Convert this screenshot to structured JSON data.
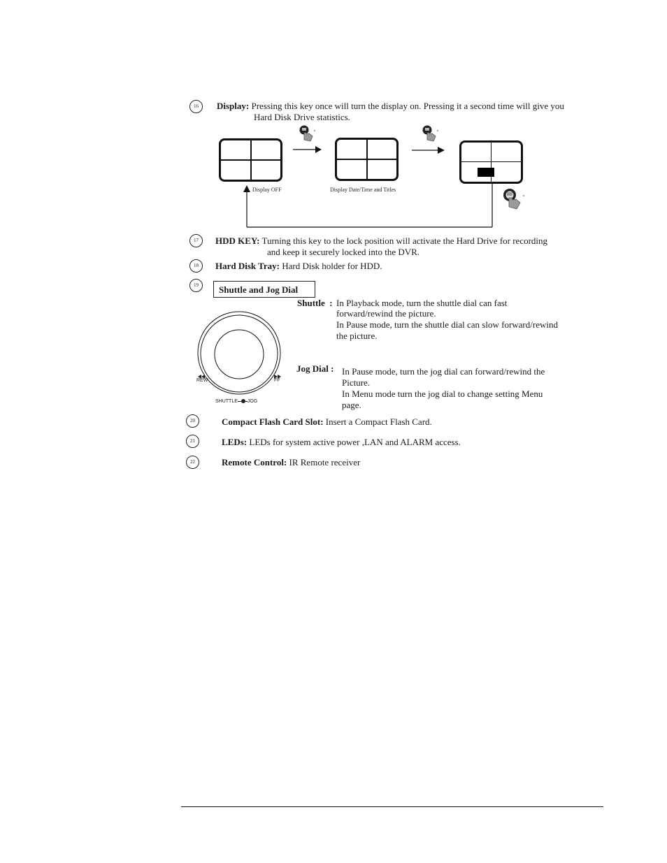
{
  "items": [
    {
      "number": "16",
      "title": "Display:",
      "line1": " Pressing this key once will turn the display on. Pressing it a second time will give you",
      "line2": "Hard Disk Drive statistics."
    },
    {
      "number": "17",
      "title": "HDD KEY:",
      "line1": " Turning this key to the lock position will activate the Hard Drive for recording",
      "line2": "and keep it securely locked into the DVR."
    },
    {
      "number": "18",
      "title": "Hard Disk Tray:",
      "line1": " Hard Disk holder for HDD."
    },
    {
      "number": "19",
      "title": "Shuttle and Jog Dial"
    },
    {
      "number": "20",
      "title": "Compact Flash Card Slot:",
      "line1": " Insert a Compact Flash Card."
    },
    {
      "number": "21",
      "title": "LEDs:",
      "line1": " LEDs for system active power ,LAN and ALARM access."
    },
    {
      "number": "22",
      "title": "Remote Control:",
      "line1": " IR Remote receiver"
    }
  ],
  "display_diagram": {
    "label_off": "Display OFF",
    "label_date": "Display Date/Time and Titles"
  },
  "shuttle": {
    "label": "Shuttle  :",
    "lines": [
      "In Playback mode, turn the shuttle dial can fast",
      "forward/rewind the picture.",
      "In Pause mode, turn the shuttle dial can slow forward/rewind",
      "the picture."
    ]
  },
  "jog": {
    "label": "Jog Dial :",
    "lines": [
      "In Pause mode, turn the jog dial can forward/rewind the",
      "Picture.",
      "In Menu mode turn the jog dial to change setting Menu",
      "page."
    ]
  },
  "dial_figure": {
    "rew_label": "REW",
    "ff_label": "FF",
    "shuttle_label": "SHUTTLE",
    "jog_label": "JOG"
  }
}
